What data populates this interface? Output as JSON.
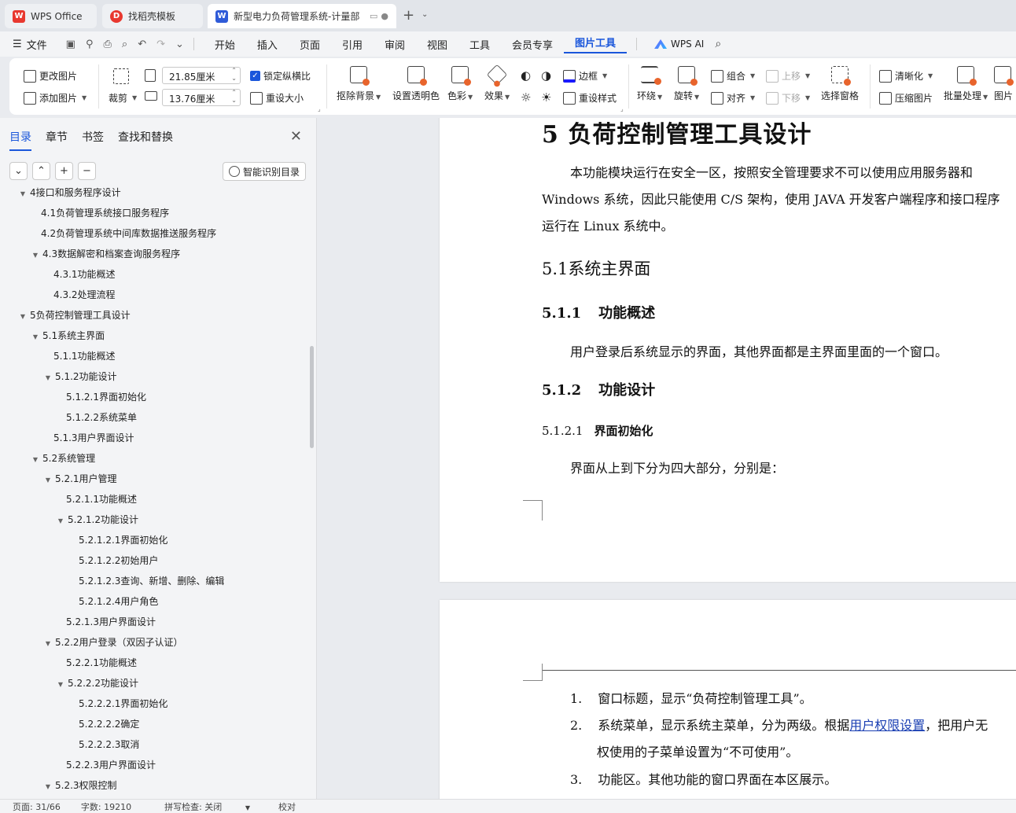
{
  "tabs": [
    {
      "label": "WPS Office",
      "icon": "wps-logo-icon"
    },
    {
      "label": "找稻壳模板",
      "icon": "daoke-icon"
    },
    {
      "label": "新型电力负荷管理系统-计量部",
      "icon": "writer-doc-icon",
      "active": true
    }
  ],
  "menubar": {
    "file": "文件",
    "items": [
      "开始",
      "插入",
      "页面",
      "引用",
      "审阅",
      "视图",
      "工具",
      "会员专享",
      "图片工具"
    ],
    "active": "图片工具",
    "ai": "WPS AI"
  },
  "ribbon": {
    "change_picture": "更改图片",
    "add_picture": "添加图片",
    "crop": "裁剪",
    "width_value": "21.85厘米",
    "height_value": "13.76厘米",
    "lock_ratio": "锁定纵横比",
    "reset_size": "重设大小",
    "remove_bg": "抠除背景",
    "set_transparent": "设置透明色",
    "color": "色彩",
    "effects": "效果",
    "border": "边框",
    "reset_style": "重设样式",
    "wrap": "环绕",
    "rotate": "旋转",
    "group": "组合",
    "align": "对齐",
    "bring_forward": "上移",
    "send_backward": "下移",
    "selection_pane": "选择窗格",
    "sharpen": "清晰化",
    "compress": "压缩图片",
    "batch": "批量处理",
    "picture_more": "图片"
  },
  "nav": {
    "tabs": [
      "目录",
      "章节",
      "书签",
      "查找和替换"
    ],
    "active_tab": "目录",
    "smart_toc": "智能识别目录",
    "toc": [
      {
        "label": "4接口和服务程序设计",
        "level": 1,
        "expanded": true
      },
      {
        "label": "4.1负荷管理系统接口服务程序",
        "level": 2,
        "leaf": true
      },
      {
        "label": "4.2负荷管理系统中间库数据推送服务程序",
        "level": 2,
        "leaf": true
      },
      {
        "label": "4.3数据解密和档案查询服务程序",
        "level": 2,
        "expanded": true
      },
      {
        "label": "4.3.1功能概述",
        "level": 3,
        "leaf": true
      },
      {
        "label": "4.3.2处理流程",
        "level": 3,
        "leaf": true
      },
      {
        "label": "5负荷控制管理工具设计",
        "level": 1,
        "expanded": true
      },
      {
        "label": "5.1系统主界面",
        "level": 2,
        "expanded": true
      },
      {
        "label": "5.1.1功能概述",
        "level": 3,
        "leaf": true
      },
      {
        "label": "5.1.2功能设计",
        "level": 3,
        "expanded": true
      },
      {
        "label": "5.1.2.1界面初始化",
        "level": 4,
        "leaf": true
      },
      {
        "label": "5.1.2.2系统菜单",
        "level": 4,
        "leaf": true
      },
      {
        "label": "5.1.3用户界面设计",
        "level": 3,
        "leaf": true
      },
      {
        "label": "5.2系统管理",
        "level": 2,
        "expanded": true
      },
      {
        "label": "5.2.1用户管理",
        "level": 3,
        "expanded": true
      },
      {
        "label": "5.2.1.1功能概述",
        "level": 4,
        "leaf": true
      },
      {
        "label": "5.2.1.2功能设计",
        "level": 4,
        "expanded": true
      },
      {
        "label": "5.2.1.2.1界面初始化",
        "level": 5,
        "leaf": true
      },
      {
        "label": "5.2.1.2.2初始用户",
        "level": 5,
        "leaf": true
      },
      {
        "label": "5.2.1.2.3查询、新增、删除、编辑",
        "level": 5,
        "leaf": true
      },
      {
        "label": "5.2.1.2.4用户角色",
        "level": 5,
        "leaf": true
      },
      {
        "label": "5.2.1.3用户界面设计",
        "level": 4,
        "leaf": true
      },
      {
        "label": "5.2.2用户登录（双因子认证）",
        "level": 3,
        "expanded": true
      },
      {
        "label": "5.2.2.1功能概述",
        "level": 4,
        "leaf": true
      },
      {
        "label": "5.2.2.2功能设计",
        "level": 4,
        "expanded": true
      },
      {
        "label": "5.2.2.2.1界面初始化",
        "level": 5,
        "leaf": true
      },
      {
        "label": "5.2.2.2.2确定",
        "level": 5,
        "leaf": true
      },
      {
        "label": "5.2.2.2.3取消",
        "level": 5,
        "leaf": true
      },
      {
        "label": "5.2.2.3用户界面设计",
        "level": 4,
        "leaf": true
      },
      {
        "label": "5.2.3权限控制",
        "level": 3,
        "expanded": true
      }
    ]
  },
  "document": {
    "h1": "5  负荷控制管理工具设计",
    "p1_line1": "本功能模块运行在安全一区，按照安全管理要求不可以使用应用服务器和",
    "p1_line2": "Windows 系统，因此只能使用 C/S 架构，使用 JAVA 开发客户端程序和接口程序",
    "p1_line3": "运行在 Linux 系统中。",
    "h2": "5.1系统主界面",
    "h3a_num": "5.1.1",
    "h3a_text": "功能概述",
    "p2": "用户登录后系统显示的界面，其他界面都是主界面里面的一个窗口。",
    "h3b_num": "5.1.2",
    "h3b_text": "功能设计",
    "h4_num": "5.1.2.1",
    "h4_text": "界面初始化",
    "p3": "界面从上到下分为四大部分，分别是：",
    "list": [
      {
        "num": "1.",
        "text": "窗口标题，显示“负荷控制管理工具”。"
      },
      {
        "num": "2.",
        "text_before": "系统菜单，显示系统主菜单，分为两级。根据",
        "link": "用户权限设置",
        "text_after": "，把用户无",
        "line2": "权使用的子菜单设置为“不可使用”。"
      },
      {
        "num": "3.",
        "text": "功能区。其他功能的窗口界面在本区展示。"
      }
    ]
  },
  "status": {
    "page": "页面: 31/66",
    "words": "字数: 19210",
    "spell": "拼写检查: 关闭",
    "proof": "校对"
  }
}
